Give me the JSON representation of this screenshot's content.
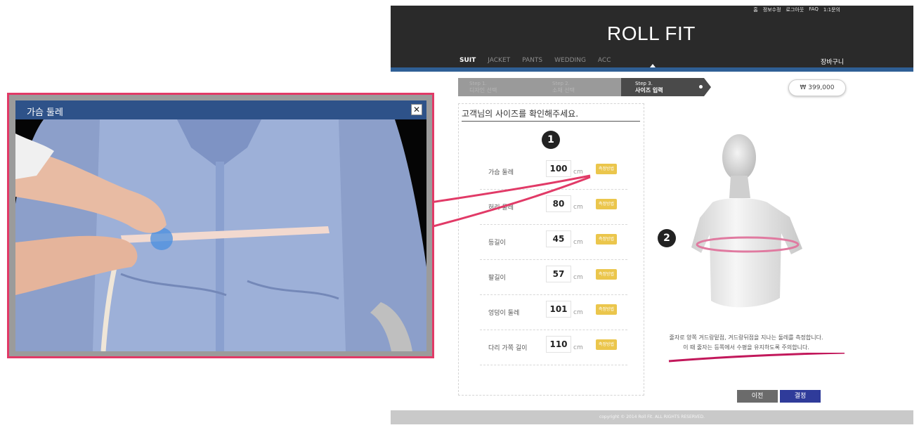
{
  "site": {
    "util_nav": [
      "홈",
      "정보수정",
      "로그아웃",
      "FAQ",
      "1:1문의"
    ],
    "logo": "ROLL FIT",
    "main_nav": [
      "SUIT",
      "JACKET",
      "PANTS",
      "WEDDING",
      "ACC"
    ],
    "active_nav": "SUIT",
    "cart": "장바구니",
    "steps": [
      {
        "num": "Step 1.",
        "label": "디자인 선택"
      },
      {
        "num": "Step 2.",
        "label": "소재 선택"
      },
      {
        "num": "Step 3.",
        "label": "사이즈 입력"
      }
    ],
    "current_step": 3,
    "price": "₩ 399,000",
    "form_title": "고객님의 사이즈를 확인해주세요.",
    "badge_1": "1",
    "badge_2": "2",
    "measurements": [
      {
        "label": "가슴 둘레",
        "value": "100",
        "unit": "cm",
        "button": "측정방법"
      },
      {
        "label": "허리 둘레",
        "value": "80",
        "unit": "cm",
        "button": "측정방법"
      },
      {
        "label": "등길이",
        "value": "45",
        "unit": "cm",
        "button": "측정방법"
      },
      {
        "label": "팔길이",
        "value": "57",
        "unit": "cm",
        "button": "측정방법"
      },
      {
        "label": "엉덩이 둘레",
        "value": "101",
        "unit": "cm",
        "button": "측정방법"
      },
      {
        "label": "다리 가쪽 길이",
        "value": "110",
        "unit": "cm",
        "button": "측정방법"
      }
    ],
    "instructions": [
      "줄자로 양쪽 겨드랑밑점, 겨드랑뒤점을 지나는 둘레를 측정합니다.",
      "이 때 줄자는 등쪽에서 수평을 유지하도록 주의합니다."
    ],
    "prev_button": "이전",
    "confirm_button": "결정",
    "footer": "copyright © 2014 Roll Fit. ALL RIGHTS RESERVED."
  },
  "popup": {
    "title": "가슴 둘레",
    "close_icon": "close-icon"
  },
  "colors": {
    "header_bg": "#2a2a2a",
    "accent_blue": "#2f5f95",
    "popup_border": "#e13a67",
    "measure_button": "#ebc64c",
    "confirm_button": "#2f3b9a",
    "prev_button": "#6b6b6b"
  }
}
